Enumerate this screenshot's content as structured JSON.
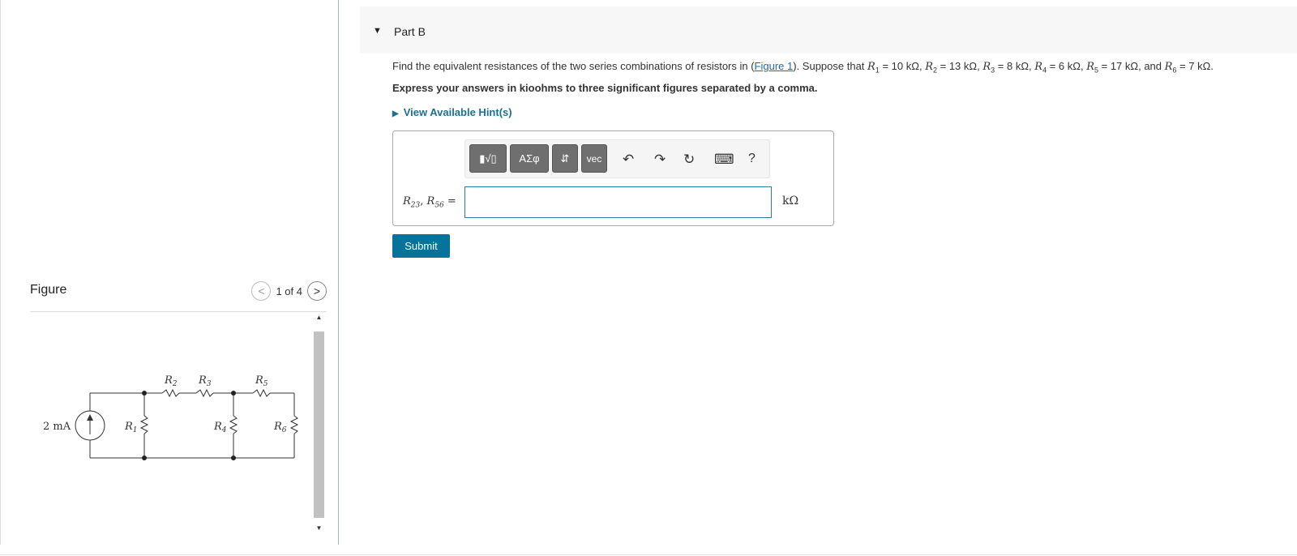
{
  "part": {
    "label": "Part B"
  },
  "question": {
    "prefix": "Find the equivalent resistances of the two series combinations of resistors in (",
    "figure_link": "Figure 1",
    "middle": "). Suppose that ",
    "values": [
      {
        "var": "R",
        "sub": "1",
        "val": " = 10 kΩ, "
      },
      {
        "var": "R",
        "sub": "2",
        "val": " = 13 kΩ, "
      },
      {
        "var": "R",
        "sub": "3",
        "val": " = 8 kΩ, "
      },
      {
        "var": "R",
        "sub": "4",
        "val": " = 6 kΩ, "
      },
      {
        "var": "R",
        "sub": "5",
        "val": " = 17 kΩ, and "
      },
      {
        "var": "R",
        "sub": "6",
        "val": " = 7 kΩ."
      }
    ],
    "instructions": "Express your answers in kioohms to three significant figures separated by a comma.",
    "hint_label": "View Available Hint(s)"
  },
  "toolbar": {
    "templates": "▮√▯",
    "greek": "ΑΣφ",
    "updown": "⇵",
    "vec": "vec",
    "undo": "↶",
    "redo": "↷",
    "reset": "↻",
    "keyboard": "⌨",
    "help": "?"
  },
  "answer": {
    "label_a": "R",
    "sub_a": "23",
    "sep": ", ",
    "label_b": "R",
    "sub_b": "56",
    "eq": " =",
    "value": "",
    "unit": "kΩ"
  },
  "submit_label": "Submit",
  "figure": {
    "title": "Figure",
    "pager": "1 of 4",
    "prev": "<",
    "next": ">",
    "circuit": {
      "source": "2 mA",
      "r1": "R",
      "r1s": "1",
      "r2": "R",
      "r2s": "2",
      "r3": "R",
      "r3s": "3",
      "r4": "R",
      "r4s": "4",
      "r5": "R",
      "r5s": "5",
      "r6": "R",
      "r6s": "6"
    }
  },
  "colors": {
    "accent": "#08739a",
    "link": "#1a6fa8",
    "hint": "#1f6f8f"
  }
}
